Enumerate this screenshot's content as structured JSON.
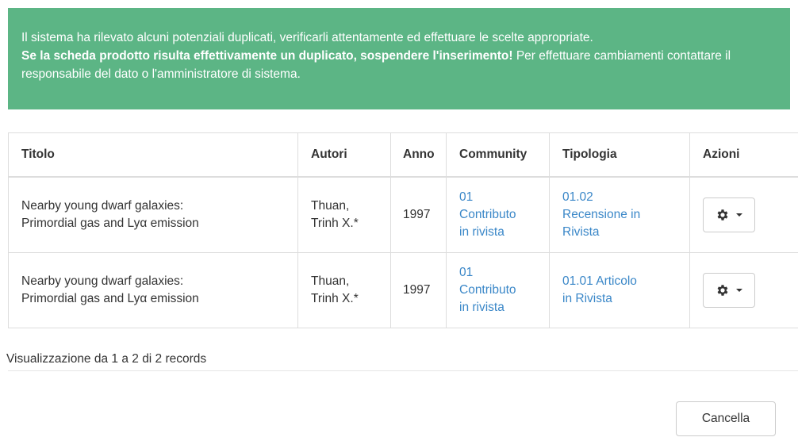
{
  "alert": {
    "line1": "Il sistema ha rilevato alcuni potenziali duplicati, verificarli attentamente ed effettuare le scelte appropriate.",
    "bold": "Se la scheda prodotto risulta effettivamente un duplicato, sospendere l'inserimento!",
    "rest": " Per effettuare cambiamenti contattare il responsabile del dato o l'amministratore di sistema."
  },
  "table": {
    "headers": {
      "titolo": "Titolo",
      "autori": "Autori",
      "anno": "Anno",
      "community": "Community",
      "tipologia": "Tipologia",
      "azioni": "Azioni"
    },
    "rows": [
      {
        "titolo_1": "Nearby young dwarf galaxies:",
        "titolo_2": "Primordial gas and Lyα emission",
        "autori_1": "Thuan,",
        "autori_2": "Trinh X.*",
        "anno": "1997",
        "community_1": "01",
        "community_2": "Contributo",
        "community_3": "in rivista",
        "tipologia_1": "01.02",
        "tipologia_2": "Recensione in",
        "tipologia_3": "Rivista",
        "action_icon": "gear-icon"
      },
      {
        "titolo_1": "Nearby young dwarf galaxies:",
        "titolo_2": "Primordial gas and Lyα emission",
        "autori_1": "Thuan,",
        "autori_2": "Trinh X.*",
        "anno": "1997",
        "community_1": "01",
        "community_2": "Contributo",
        "community_3": "in rivista",
        "tipologia_1": "01.01 Articolo",
        "tipologia_2": "in Rivista",
        "tipologia_3": "",
        "action_icon": "gear-icon"
      }
    ]
  },
  "footer": {
    "info": "Visualizzazione da 1 a 2 di 2 records",
    "cancel_label": "Cancella"
  },
  "colors": {
    "alert_bg": "#5cb585",
    "link": "#3a87c8",
    "border": "#dddddd"
  }
}
